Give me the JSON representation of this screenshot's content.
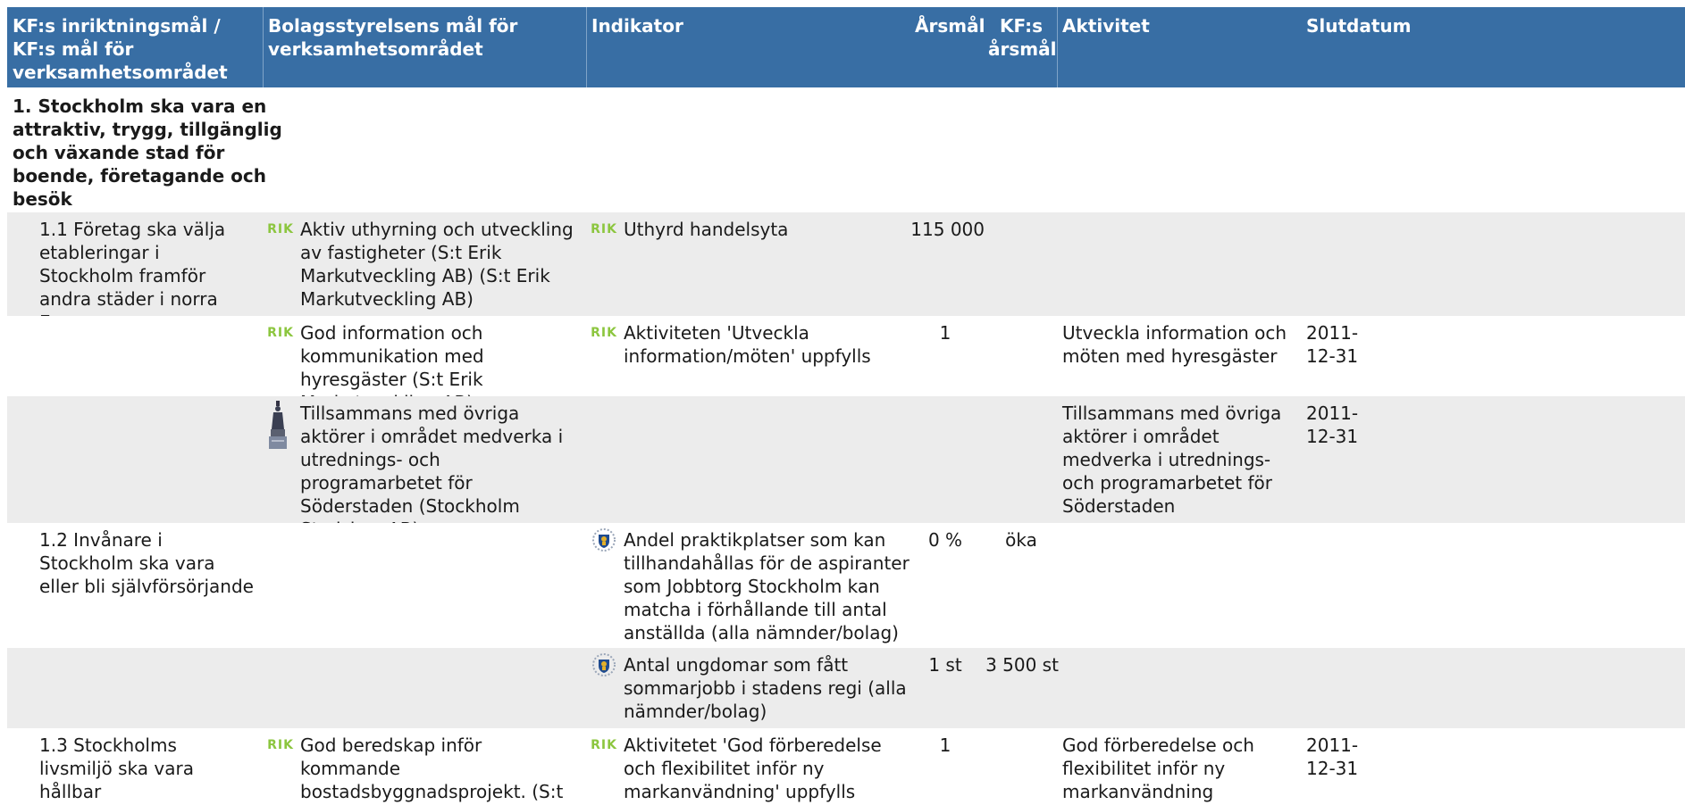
{
  "header": {
    "col1": "KF:s inriktningsmål / KF:s mål för verksamhetsområdet",
    "col2": "Bolagsstyrelsens mål för verksamhetsområdet",
    "col3": "Indikator",
    "col4": "Årsmål",
    "col5": "KF:s årsmål",
    "col6": "Aktivitet",
    "col7": "Slutdatum"
  },
  "category": "1. Stockholm ska vara en attraktiv, trygg, tillgänglig och växande stad för boende, företagande och besök",
  "rows": [
    {
      "kf_goal": "1.1 Företag ska välja etableringar i Stockholm framför andra städer i norra Europa",
      "board_goal": "Aktiv uthyrning och utveckling av fastigheter (S:t Erik Markutveckling AB) (S:t Erik Markutveckling AB)",
      "board_icon": "rik-logo-icon",
      "indicator": "Uthyrd handelsyta",
      "indicator_icon": "rik-logo-icon",
      "annual": "115 000",
      "kf_annual": "",
      "activity": "",
      "end_date": ""
    },
    {
      "kf_goal": "",
      "board_goal": "God information och kommunikation med hyresgäster (S:t Erik Markutveckling AB)",
      "board_icon": "rik-logo-icon",
      "indicator": "Aktiviteten 'Utveckla information/möten' uppfylls",
      "indicator_icon": "rik-logo-icon",
      "annual": "1",
      "kf_annual": "",
      "activity": "Utveckla information och möten med hyresgäster",
      "end_date": "2011-12-31"
    },
    {
      "kf_goal": "",
      "board_goal": "Tillsammans med övriga aktörer i området medverka i utrednings- och programarbetet för Söderstaden (Stockholm Stadshus AB)",
      "board_icon": "stadshus-statue-icon",
      "indicator": "",
      "indicator_icon": "",
      "annual": "",
      "kf_annual": "",
      "activity": "Tillsammans med övriga aktörer i området medverka i utrednings- och programarbetet för Söderstaden",
      "end_date": "2011-12-31"
    },
    {
      "kf_goal": "1.2 Invånare i Stockholm ska vara eller bli självförsörjande",
      "board_goal": "",
      "board_icon": "",
      "indicator": "Andel praktikplatser som kan tillhandahållas för de aspiranter som Jobbtorg Stockholm kan matcha i förhållande till antal anställda (alla nämnder/bolag)",
      "indicator_icon": "stockholm-crest-icon",
      "annual": "0 %",
      "kf_annual": "öka",
      "activity": "",
      "end_date": ""
    },
    {
      "kf_goal": "",
      "board_goal": "",
      "board_icon": "",
      "indicator": "Antal ungdomar som fått sommarjobb i stadens regi (alla nämnder/bolag)",
      "indicator_icon": "stockholm-crest-icon",
      "annual": "1 st",
      "kf_annual": "3 500 st",
      "activity": "",
      "end_date": ""
    },
    {
      "kf_goal": "1.3 Stockholms livsmiljö ska vara hållbar",
      "board_goal": "God beredskap inför kommande bostadsbyggnadsprojekt. (S:t Erik Markutveckling AB)",
      "board_icon": "rik-logo-icon",
      "indicator": "Aktivitetet 'God förberedelse och flexibilitet inför ny markanvändning' uppfylls",
      "indicator_icon": "rik-logo-icon",
      "annual": "1",
      "kf_annual": "",
      "activity": "God förberedelse och flexibilitet inför ny markanvändning",
      "end_date": "2011-12-31"
    }
  ],
  "logo_text": "RIK",
  "colors": {
    "header_bg": "#386ea4",
    "header_text": "#ffffff",
    "row_alt": "#ececec",
    "rik_green": "#8cc63f"
  }
}
